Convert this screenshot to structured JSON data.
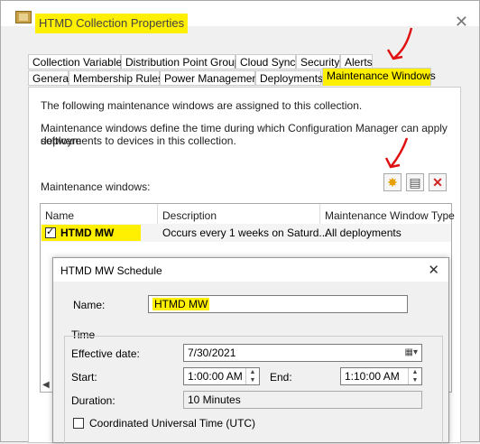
{
  "window": {
    "title": "HTMD Collection Properties",
    "close": "✕"
  },
  "tabs_row1": [
    "Collection Variables",
    "Distribution Point Groups",
    "Cloud Sync",
    "Security",
    "Alerts"
  ],
  "tabs_row2": [
    "General",
    "Membership Rules",
    "Power Management",
    "Deployments",
    "Maintenance Windows"
  ],
  "panel": {
    "intro": "The following maintenance windows are assigned to this collection.",
    "desc_line1": "Maintenance windows define the time during which Configuration Manager can apply software",
    "desc_line2": "deployments to devices in this collection.",
    "list_label": "Maintenance windows:"
  },
  "toolbar": {
    "new_icon": "new-star-icon",
    "properties_icon": "properties-icon",
    "delete_icon": "delete-icon"
  },
  "list": {
    "columns": [
      "Name",
      "Description",
      "Maintenance Window Type"
    ],
    "rows": [
      {
        "name": "HTMD MW",
        "description": "Occurs every 1 weeks on Saturd...",
        "type": "All deployments",
        "checked": true
      }
    ]
  },
  "dialog": {
    "title": "HTMD MW Schedule",
    "close": "✕",
    "name_label": "Name:",
    "name_value": "HTMD MW",
    "time_group": "Time",
    "effective_label": "Effective date:",
    "effective_value": "7/30/2021",
    "start_label": "Start:",
    "start_value": "1:00:00 AM",
    "end_label": "End:",
    "end_value": "1:10:00 AM",
    "duration_label": "Duration:",
    "duration_value": "10 Minutes",
    "utc_label": "Coordinated Universal Time (UTC)"
  },
  "colors": {
    "highlight": "#ffef00",
    "annotation": "#e01010"
  }
}
